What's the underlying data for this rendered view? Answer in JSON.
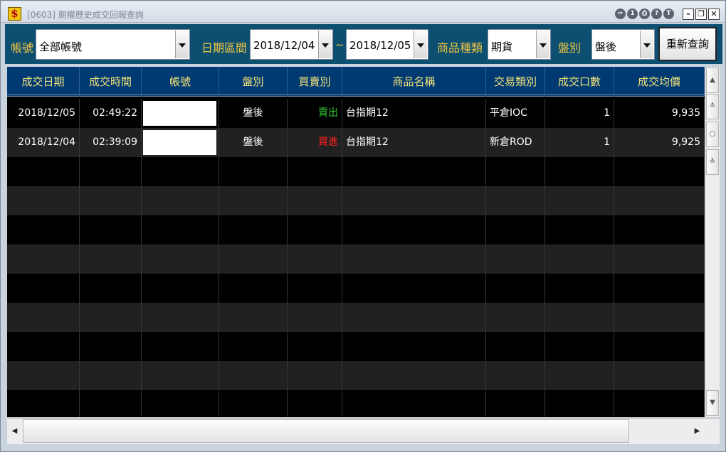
{
  "window": {
    "title": "[0603] 期權歷史成交回報查詢",
    "app_icon_glyph": "$",
    "toolbar_icons": [
      "export-icon",
      "info-icon",
      "print-icon",
      "help-icon",
      "topmost-icon"
    ],
    "toolbar_glyphs": [
      "⇨",
      "1",
      "⎙",
      "?",
      "T"
    ],
    "controls": {
      "minimize": "–",
      "maximize": "❐",
      "close": "✕"
    }
  },
  "filters": {
    "account_label": "帳號",
    "account_value": "全部帳號",
    "date_range_label": "日期區間",
    "date_from": "2018/12/04",
    "date_to": "2018/12/05",
    "range_separator": "~",
    "product_type_label": "商品種類",
    "product_type_value": "期貨",
    "session_label": "盤別",
    "session_value": "盤後",
    "query_button": "重新查詢"
  },
  "table": {
    "columns": [
      "成交日期",
      "成交時間",
      "帳號",
      "盤別",
      "買賣別",
      "商品名稱",
      "交易類別",
      "成交口數",
      "成交均價"
    ],
    "rows": [
      {
        "date": "2018/12/05",
        "time": "02:49:22",
        "account": "",
        "session": "盤後",
        "side": "賣出",
        "product": "台指期12",
        "trade_type": "平倉IOC",
        "qty": "1",
        "avg_price": "9,935"
      },
      {
        "date": "2018/12/04",
        "time": "02:39:09",
        "account": "",
        "session": "盤後",
        "side": "買進",
        "product": "台指期12",
        "trade_type": "新倉ROD",
        "qty": "1",
        "avg_price": "9,925"
      }
    ]
  },
  "scrollbars": {
    "vertical_glyphs": [
      "▲",
      "≛",
      "○",
      "≚",
      "▼"
    ],
    "horizontal_glyphs": [
      "◀",
      "▶"
    ]
  },
  "colors": {
    "filter_bar_bg": "#0d4f70",
    "label_text": "#f2c641",
    "header_bg": "#013a72",
    "header_text": "#f2e27a",
    "sell": "#33cc33",
    "buy": "#ff2020",
    "grid_bg": "#000000",
    "grid_alt_row": "#212121"
  }
}
